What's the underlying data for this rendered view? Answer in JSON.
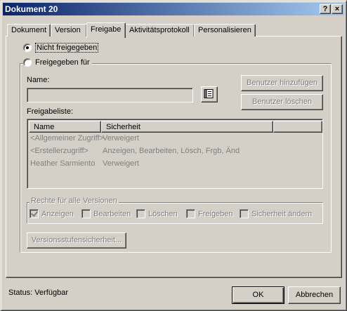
{
  "window": {
    "title": "Dokument 20",
    "help_label": "?",
    "close_label": "×"
  },
  "tabs": [
    {
      "label": "Dokument"
    },
    {
      "label": "Version"
    },
    {
      "label": "Freigabe"
    },
    {
      "label": "Aktivitätsprotokoll"
    },
    {
      "label": "Personalisieren"
    }
  ],
  "sharing": {
    "not_shared_label": "Nicht freigegeben",
    "not_shared_selected": true,
    "shared_for_label": "Freigegeben für",
    "name_label": "Name:",
    "name_value": "",
    "add_user_label": "Benutzer hinzufügen",
    "delete_user_label": "Benutzer löschen",
    "list_label": "Freigabeliste:",
    "columns": [
      "Name",
      "Sicherheit"
    ],
    "rows": [
      {
        "name": "<Allgemeiner Zugriff>",
        "security": "Verweigert"
      },
      {
        "name": "<Erstellerzugriff>",
        "security": "Anzeigen, Bearbeiten, Lösch, Frgb, Änd"
      },
      {
        "name": "Heather Sarmiento",
        "security": "Verweigert"
      }
    ]
  },
  "rights": {
    "group_label": "Rechte für alle Versionen",
    "items": [
      {
        "label": "Anzeigen",
        "checked": true
      },
      {
        "label": "Bearbeiten",
        "checked": false
      },
      {
        "label": "Löschen",
        "checked": false
      },
      {
        "label": "Freigeben",
        "checked": false
      },
      {
        "label": "Sicherheit ändern",
        "checked": false
      }
    ]
  },
  "version_security_label": "Versionsstufensicherheit...",
  "status": {
    "text": "Status: Verfügbar"
  },
  "footer": {
    "ok_label": "OK",
    "cancel_label": "Abbrechen"
  }
}
